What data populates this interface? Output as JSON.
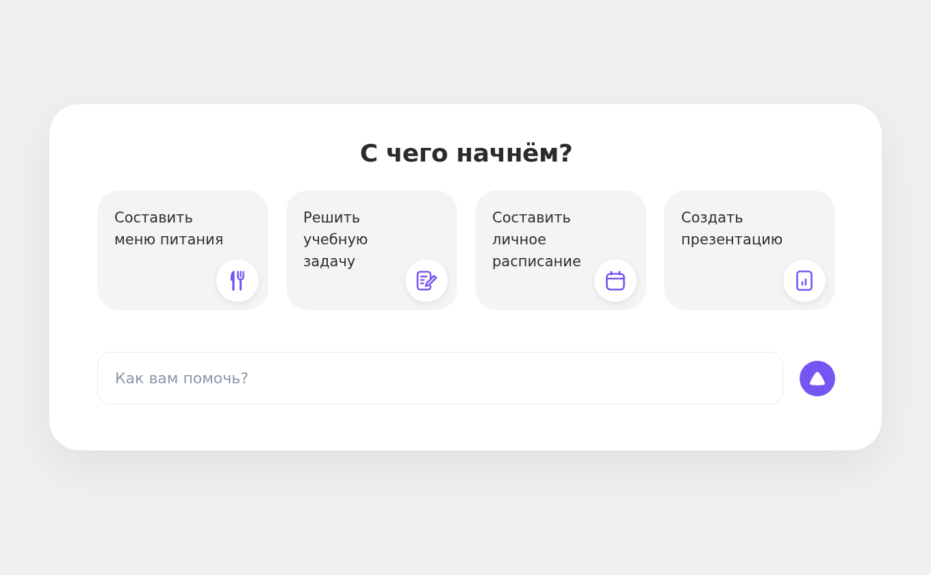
{
  "title": "С чего начнём?",
  "suggestions": [
    {
      "kind": "meal",
      "label": "Составить\nменю питания"
    },
    {
      "kind": "study",
      "label": "Решить\nучебную\nзадачу"
    },
    {
      "kind": "schedule",
      "label": "Составить\nличное\nрасписание"
    },
    {
      "kind": "presentation",
      "label": "Создать\nпрезентацию"
    }
  ],
  "prompt": {
    "placeholder": "Как вам помочь?"
  }
}
